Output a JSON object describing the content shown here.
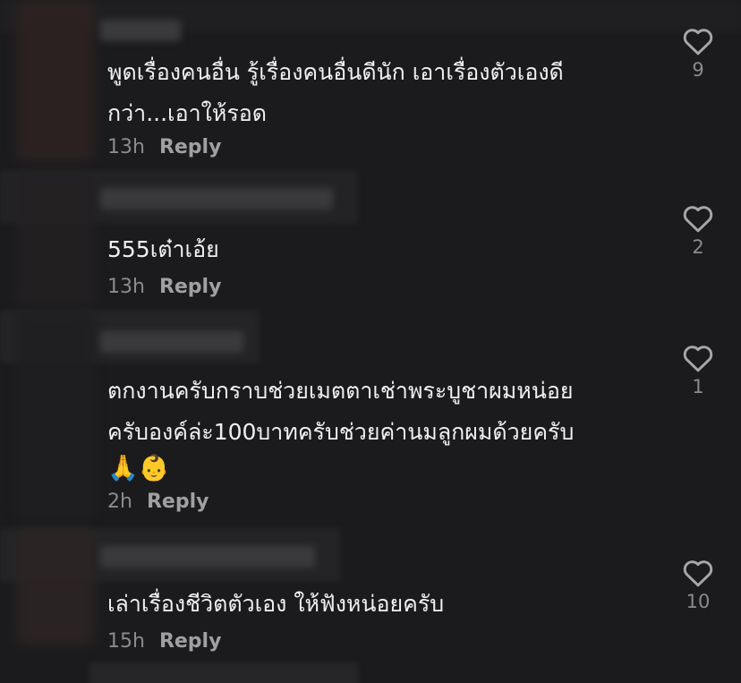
{
  "comments": [
    {
      "text_line1": "พูดเรื่องคนอื่น รู้เรื่องคนอื่นดีนัก เอาเรื่องตัวเองดี",
      "text_line2": "กว่า...เอาให้รอด",
      "time": "13h",
      "reply_label": "Reply",
      "likes": "9"
    },
    {
      "text_line1": "555เต๋าเอ้ย",
      "time": "13h",
      "reply_label": "Reply",
      "likes": "2"
    },
    {
      "text_line1": "ตกงานครับกราบช่วยเมตตาเช่าพระบูชาผมหน่อย",
      "text_line2": "ครับองค์ล่ะ100บาทครับช่วยค่านมลูกผมด้วยครับ",
      "emoji": "🙏👶",
      "time": "2h",
      "reply_label": "Reply",
      "likes": "1"
    },
    {
      "text_line1": "เล่าเรื่องชีวิตตัวเอง ให้ฟังหน่อยครับ",
      "time": "15h",
      "reply_label": "Reply",
      "likes": "10"
    }
  ],
  "colors": {
    "background": "#1b1b1d",
    "text": "#f0f0f0",
    "muted": "#8b8b8e",
    "heart_stroke": "#a7a7aa"
  },
  "icons": {
    "like": "heart-outline-icon"
  }
}
